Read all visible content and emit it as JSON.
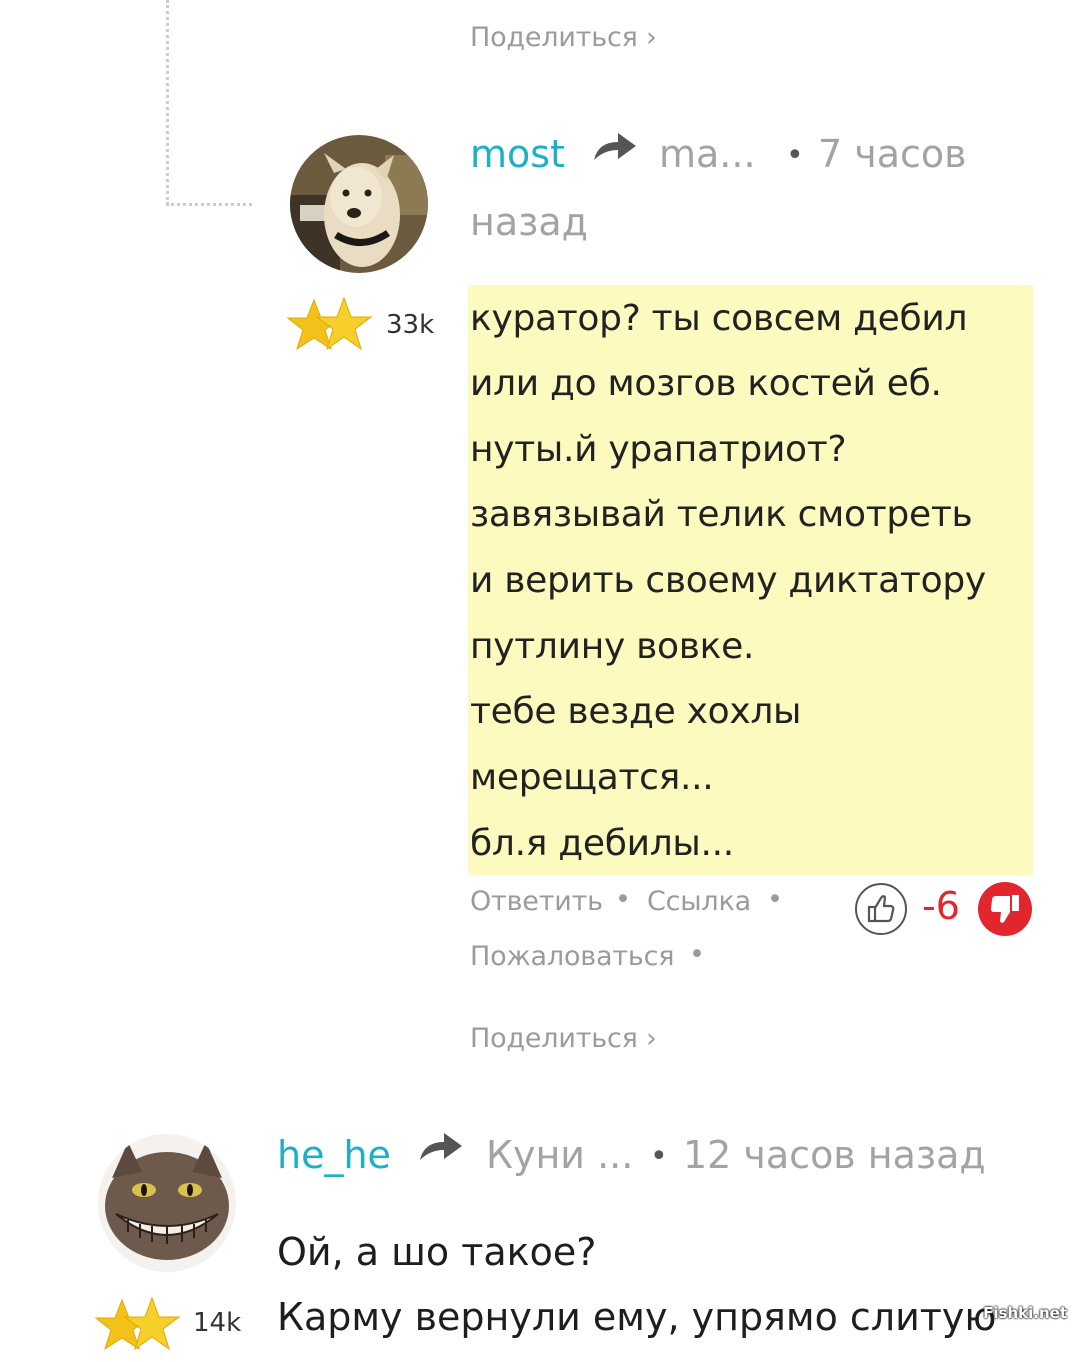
{
  "previous_comment": {
    "share_label": "Поделиться ›"
  },
  "comment_most": {
    "author": "most",
    "reply_to": "ma...",
    "time_line1": "7 часов",
    "time_line2": "назад",
    "karma": "33k",
    "text_lines": [
      "куратор? ты совсем дебил",
      "или до мозгов костей еб.",
      "нуты.й урапатриот?",
      "завязывай телик смотреть",
      "и верить своему диктатору",
      "путлину вовке.",
      "тебе везде хохлы",
      "мерещатся...",
      "бл.я дебилы..."
    ],
    "actions": {
      "reply": "Ответить",
      "link": "Ссылка",
      "report": "Пожаловаться",
      "share": "Поделиться ›"
    },
    "score": "-6"
  },
  "comment_hehe": {
    "author": "he_he",
    "reply_to": "Куни ...",
    "time": "12 часов назад",
    "karma": "14k",
    "text_line1": "Ой, а шо такое?",
    "text_line2": "Карму вернули ему, упрямо слитую"
  },
  "watermark": "Fishki.net",
  "colors": {
    "author": "#1cb0c7",
    "highlight": "#fdfac0",
    "negative": "#e3262e",
    "star": "#f5c518"
  }
}
